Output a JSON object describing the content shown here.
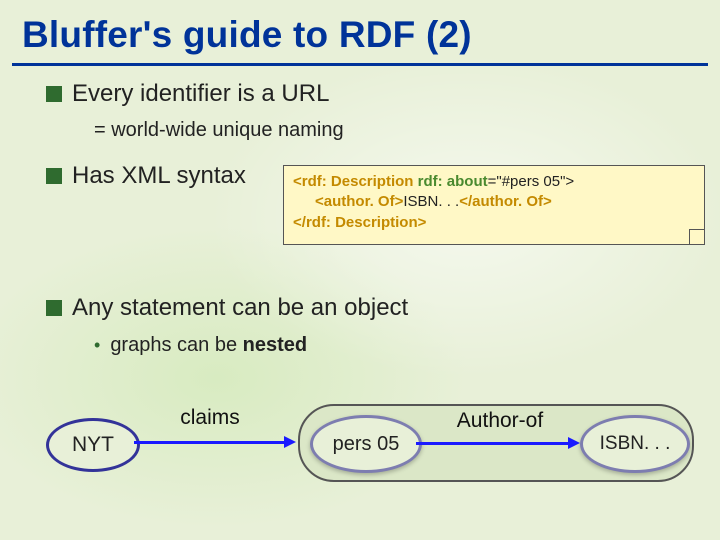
{
  "title": "Bluffer's guide to RDF (2)",
  "bullets": {
    "b1": "Every identifier is a URL",
    "b1sub": "= world-wide unique naming",
    "b2": "Has XML syntax",
    "b3": "Any statement can be an object",
    "b3sub_prefix": "graphs can be ",
    "b3sub_bold": "nested"
  },
  "code": {
    "l1_open_tag": "rdf: Description",
    "l1_attr": "rdf: about",
    "l1_val": "=\"#pers 05\">",
    "l2_open": "author. Of",
    "l2_text": "ISBN. . .",
    "l2_close": "author. Of",
    "l3_close": "rdf: Description"
  },
  "graph": {
    "node_nyt": "NYT",
    "edge_claims": "claims",
    "node_pers": "pers 05",
    "edge_author": "Author-of",
    "node_isbn": "ISBN. . ."
  }
}
